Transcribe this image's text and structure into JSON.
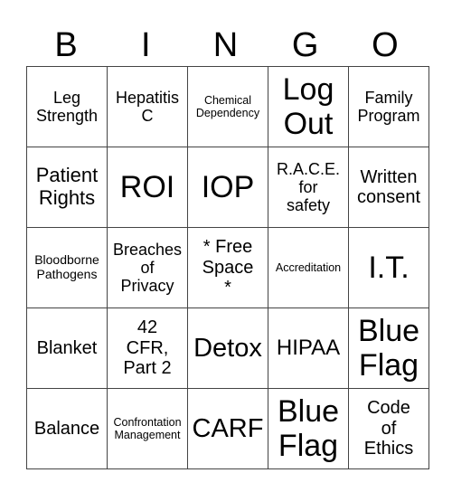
{
  "header": [
    "B",
    "I",
    "N",
    "G",
    "O"
  ],
  "grid": [
    [
      "Leg\nStrength",
      "Hepatitis\nC",
      "Chemical\nDependency",
      "Log\nOut",
      "Family\nProgram"
    ],
    [
      "Patient\nRights",
      "ROI",
      "IOP",
      "R.A.C.E.\nfor\nsafety",
      "Written\nconsent"
    ],
    [
      "Bloodborne\nPathogens",
      "Breaches\nof\nPrivacy",
      "* Free\nSpace\n*",
      "Accreditation",
      "I.T."
    ],
    [
      "Blanket",
      "42\nCFR,\nPart 2",
      "Detox",
      "HIPAA",
      "Blue\nFlag"
    ],
    [
      "Balance",
      "Confrontation\nManagement",
      "CARF",
      "Blue\nFlag",
      "Code\nof\nEthics"
    ]
  ]
}
